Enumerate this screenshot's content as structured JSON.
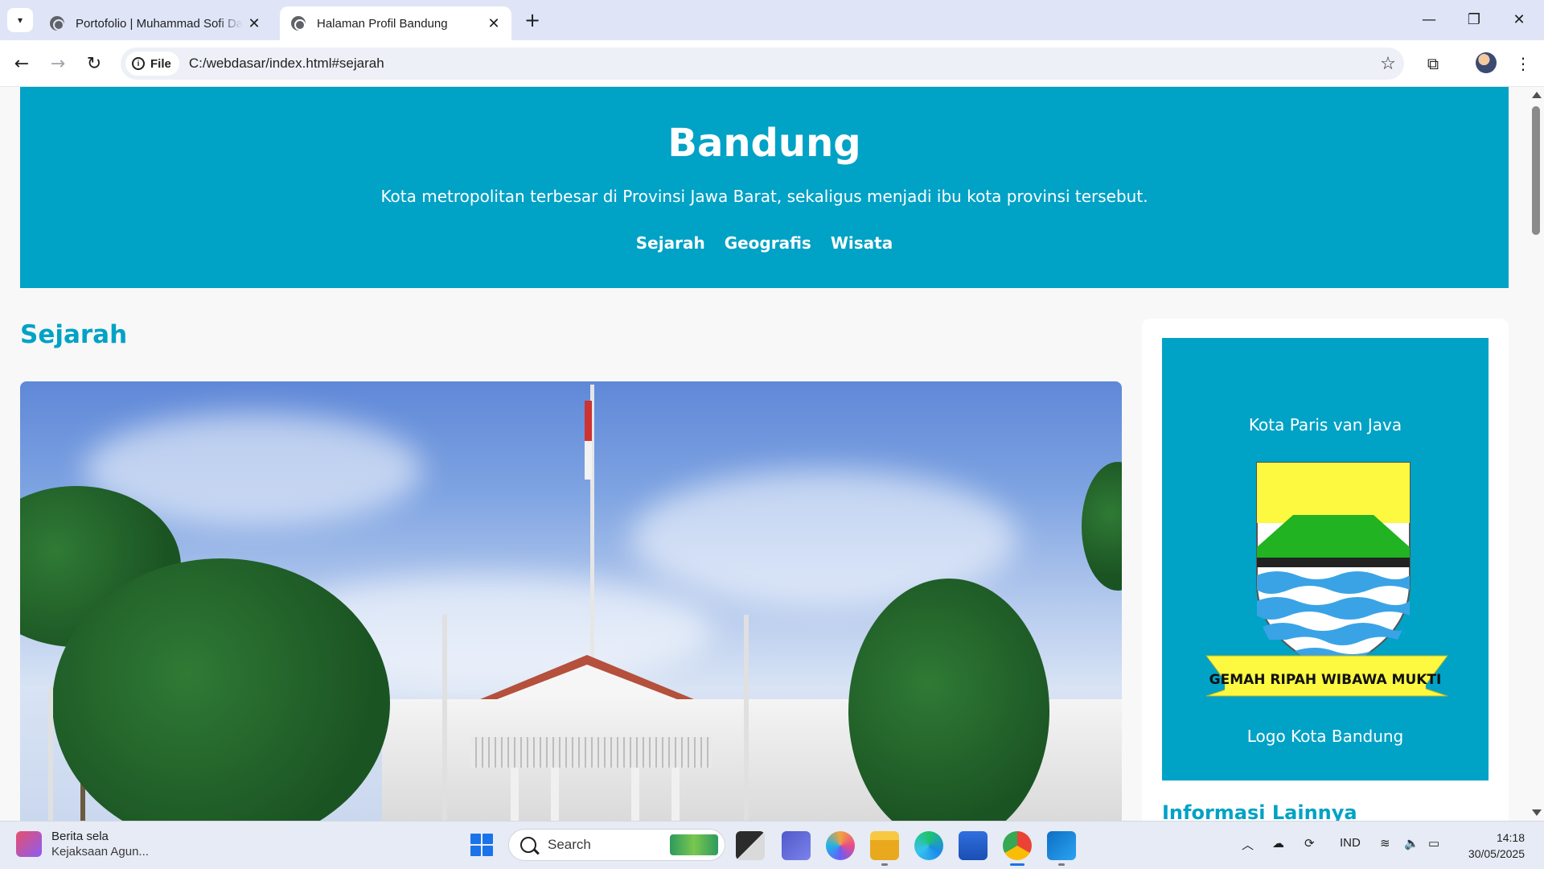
{
  "browser": {
    "tabs": [
      {
        "title": "Portofolio | Muhammad Sofi Da",
        "active": false
      },
      {
        "title": "Halaman Profil Bandung",
        "active": true
      }
    ],
    "address": {
      "scheme_chip": "File",
      "url": "C:/webdasar/index.html#sejarah"
    }
  },
  "page": {
    "hero": {
      "title": "Bandung",
      "subtitle": "Kota metropolitan terbesar di Provinsi Jawa Barat, sekaligus menjadi ibu kota provinsi tersebut.",
      "nav": [
        "Sejarah",
        "Geografis",
        "Wisata"
      ]
    },
    "section_title": "Sejarah",
    "sidebar": {
      "caption_top": "Kota Paris van Java",
      "caption_bottom": "Logo Kota Bandung",
      "emblem_motto": "GEMAH RIPAH WIBAWA MUKTI",
      "heading": "Informasi Lainnya"
    },
    "colors": {
      "primary": "#00a2c6",
      "background": "#f8f8f8"
    }
  },
  "taskbar": {
    "news": {
      "title": "Berita sela",
      "subtitle": "Kejaksaan Agun..."
    },
    "search_label": "Search",
    "language": "IND",
    "time": "14:18",
    "date": "30/05/2025"
  }
}
